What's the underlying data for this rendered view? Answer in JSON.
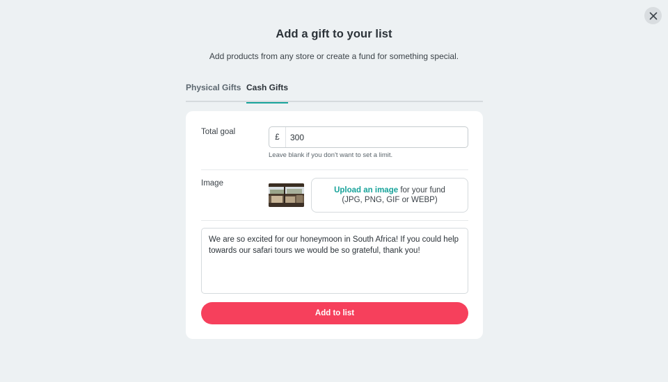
{
  "modal": {
    "title": "Add a gift to your list",
    "subtitle": "Add products from any store or create a fund for something special.",
    "close_icon": "close-icon"
  },
  "tabs": [
    {
      "label": "Physical Gifts",
      "active": false
    },
    {
      "label": "Cash Gifts",
      "active": true
    }
  ],
  "form": {
    "total_goal": {
      "label": "Total goal",
      "currency": "£",
      "value": "300",
      "hint": "Leave blank if you don't want to set a limit."
    },
    "image": {
      "label": "Image",
      "thumbnail_icon": "safari-photo-thumbnail",
      "upload_link": "Upload an image",
      "upload_text": " for your fund",
      "upload_formats": "(JPG, PNG, GIF or WEBP)"
    },
    "message": "We are so excited for our honeymoon in South Africa! If you could help towards our safari tours we would be so grateful, thank you!",
    "submit_label": "Add to list"
  },
  "colors": {
    "accent": "#17a39a",
    "primary_button": "#f6405c",
    "background": "#edf1f3",
    "card": "#ffffff"
  }
}
